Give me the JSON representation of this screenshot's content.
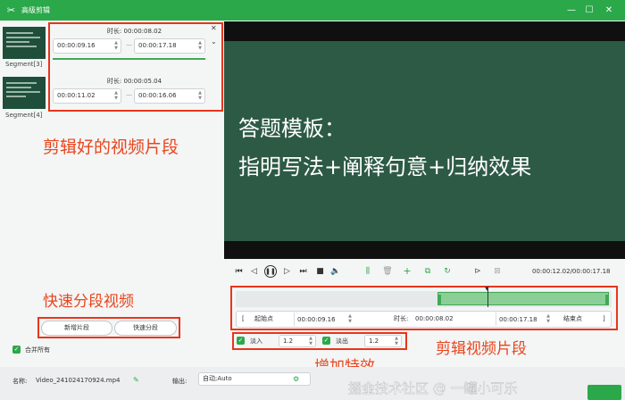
{
  "window": {
    "title": "高级剪辑"
  },
  "segments": {
    "left_labels": [
      "Segment[3]",
      "Segment[4]"
    ],
    "cards": [
      {
        "duration": "时长: 00:00:08.02",
        "start": "00:00:09.16",
        "end": "00:00:17.18"
      },
      {
        "duration": "时长: 00:00:05.04",
        "start": "00:00:11.02",
        "end": "00:00:16.06"
      }
    ]
  },
  "split": {
    "add_label": "新增片段",
    "quick_label": "快速分段"
  },
  "merge_all_label": "合并所有",
  "video": {
    "line1": "答题模板：",
    "line2": "指明写法+阐释句意+归纳效果"
  },
  "player": {
    "time": "00:00:12.02/00:00:17.18"
  },
  "trim": {
    "start_label": "起始点",
    "start_value": "00:00:09.16",
    "duration_label": "时长:",
    "duration_value": "00:00:08.02",
    "end_value": "00:00:17.18",
    "end_label": "结束点"
  },
  "effects": {
    "fade_in_label": "淡入",
    "fade_in_value": "1.2",
    "fade_out_label": "淡出",
    "fade_out_value": "1.2"
  },
  "status": {
    "name_label": "名称:",
    "name_value": "Video_241024170924.mp4",
    "output_label": "输出:",
    "output_value": "自动;Auto"
  },
  "annotations": {
    "segments": "剪辑好的视频片段",
    "split": "快速分段视频",
    "effects": "增加特效",
    "clip": "剪辑视频片段"
  },
  "watermark": "掘金技术社区 @ 一罐小可乐",
  "colors": {
    "accent": "#2ba84a",
    "annotation_red": "#e8351c",
    "board": "#2d5a45"
  }
}
